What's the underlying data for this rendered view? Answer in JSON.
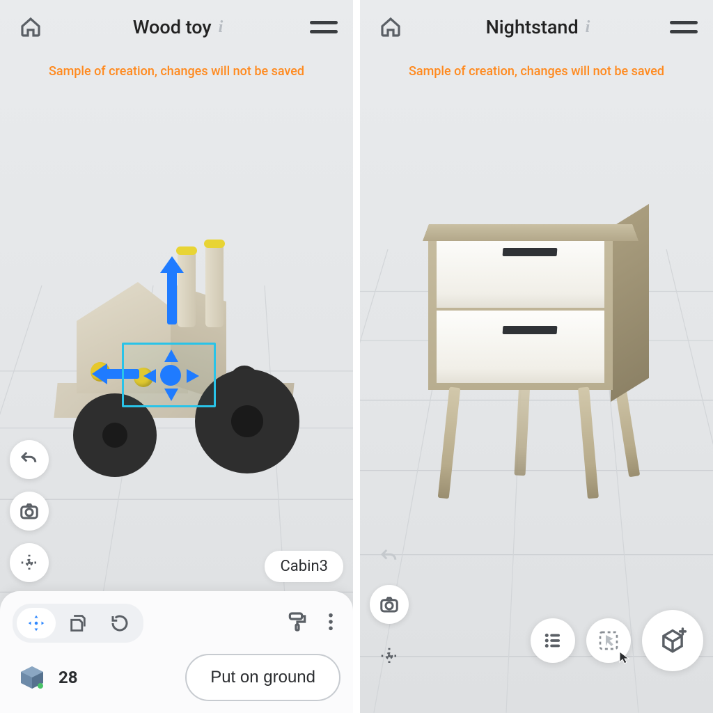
{
  "left": {
    "title": "Wood toy",
    "warning": "Sample of creation, changes will not be saved",
    "selection_label": "Cabin3",
    "part_count": "28",
    "ground_button": "Put on ground",
    "icons": {
      "home": "home-icon",
      "info": "info-icon",
      "menu": "menu-icon",
      "undo": "undo-icon",
      "camera": "camera-icon",
      "focus": "focus-target-icon",
      "move": "move-gizmo-icon",
      "clone": "duplicate-icon",
      "reset": "reset-rotation-icon",
      "paint": "paint-roller-icon",
      "more": "more-vert-icon",
      "part_cube": "part-cube-icon"
    }
  },
  "right": {
    "title": "Nightstand",
    "warning": "Sample of creation, changes will not be saved",
    "icons": {
      "home": "home-icon",
      "info": "info-icon",
      "menu": "menu-icon",
      "undo": "undo-icon",
      "camera": "camera-icon",
      "focus": "focus-target-icon",
      "list": "list-icon",
      "select": "select-box-icon",
      "add_shape": "add-shape-icon"
    }
  },
  "colors": {
    "accent": "#1f7bff",
    "warning": "#ff8a1f",
    "selection": "#29c3e8"
  }
}
